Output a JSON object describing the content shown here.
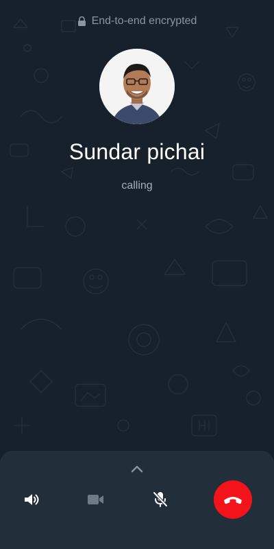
{
  "header": {
    "encryption_text": "End-to-end encrypted"
  },
  "call": {
    "contact_name": "Sundar pichai",
    "status": "calling"
  },
  "controls": [
    {
      "name": "speaker",
      "icon": "speaker-icon"
    },
    {
      "name": "video",
      "icon": "video-camera-icon"
    },
    {
      "name": "mute",
      "icon": "mic-off-icon"
    },
    {
      "name": "end-call",
      "icon": "phone-hangup-icon"
    }
  ],
  "colors": {
    "background": "#17212b",
    "panel": "#222e3a",
    "end_call": "#f2141a",
    "secondary_text": "#8b96a0"
  }
}
